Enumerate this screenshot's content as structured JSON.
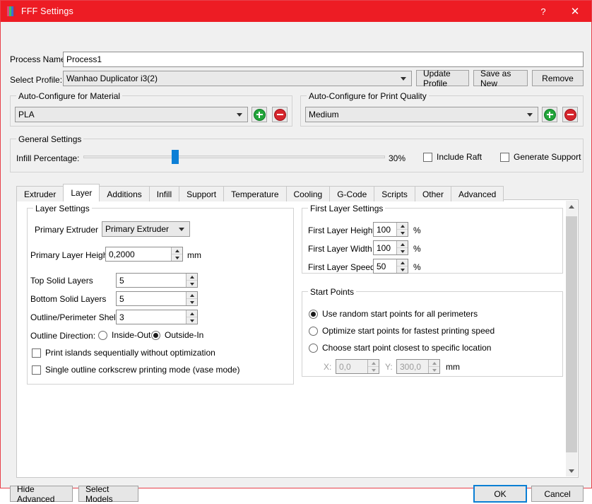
{
  "window": {
    "title": "FFF Settings",
    "help_label": "?",
    "close_label": "✕",
    "accent_color": "#ed1c24"
  },
  "header": {
    "process_name_label": "Process Name:",
    "process_name_value": "Process1",
    "select_profile_label": "Select Profile:",
    "select_profile_value": "Wanhao Duplicator i3(2)",
    "update_profile_label": "Update Profile",
    "save_as_new_label": "Save as New",
    "remove_label": "Remove"
  },
  "material_group": {
    "title": "Auto-Configure for Material",
    "value": "PLA",
    "add_label": "+",
    "remove_label": "−"
  },
  "quality_group": {
    "title": "Auto-Configure for Print Quality",
    "value": "Medium",
    "add_label": "+",
    "remove_label": "−"
  },
  "general_settings": {
    "title": "General Settings",
    "infill_label": "Infill Percentage:",
    "infill_value": "30%",
    "infill_percent": 30,
    "include_raft_label": "Include Raft",
    "include_raft_checked": false,
    "generate_support_label": "Generate Support",
    "generate_support_checked": false
  },
  "tabs": {
    "active": "Layer",
    "items": [
      {
        "label": "Extruder"
      },
      {
        "label": "Layer"
      },
      {
        "label": "Additions"
      },
      {
        "label": "Infill"
      },
      {
        "label": "Support"
      },
      {
        "label": "Temperature"
      },
      {
        "label": "Cooling"
      },
      {
        "label": "G-Code"
      },
      {
        "label": "Scripts"
      },
      {
        "label": "Other"
      },
      {
        "label": "Advanced"
      }
    ]
  },
  "layer_settings": {
    "title": "Layer Settings",
    "primary_extruder_label": "Primary Extruder",
    "primary_extruder_value": "Primary Extruder",
    "primary_layer_height_label": "Primary Layer Height",
    "primary_layer_height_value": "0,2000",
    "primary_layer_height_unit": "mm",
    "top_solid_layers_label": "Top Solid Layers",
    "top_solid_layers_value": "5",
    "bottom_solid_layers_label": "Bottom Solid Layers",
    "bottom_solid_layers_value": "5",
    "outline_shells_label": "Outline/Perimeter Shells",
    "outline_shells_value": "3",
    "outline_direction_label": "Outline Direction:",
    "inside_out_label": "Inside-Out",
    "inside_out_selected": false,
    "outside_in_label": "Outside-In",
    "outside_in_selected": true,
    "print_islands_label": "Print islands sequentially without optimization",
    "print_islands_checked": false,
    "vase_mode_label": "Single outline corkscrew printing mode (vase mode)",
    "vase_mode_checked": false
  },
  "first_layer_settings": {
    "title": "First Layer Settings",
    "height_label": "First Layer Height",
    "height_value": "100",
    "height_unit": "%",
    "width_label": "First Layer Width",
    "width_value": "100",
    "width_unit": "%",
    "speed_label": "First Layer Speed",
    "speed_value": "50",
    "speed_unit": "%"
  },
  "start_points": {
    "title": "Start Points",
    "random_label": "Use random start points for all perimeters",
    "random_selected": true,
    "optimize_label": "Optimize start points for fastest printing speed",
    "optimize_selected": false,
    "specific_label": "Choose start point closest to specific location",
    "specific_selected": false,
    "x_label": "X:",
    "x_value": "0,0",
    "y_label": "Y:",
    "y_value": "300,0",
    "unit": "mm"
  },
  "footer": {
    "hide_advanced_label": "Hide Advanced",
    "select_models_label": "Select Models",
    "ok_label": "OK",
    "cancel_label": "Cancel"
  }
}
